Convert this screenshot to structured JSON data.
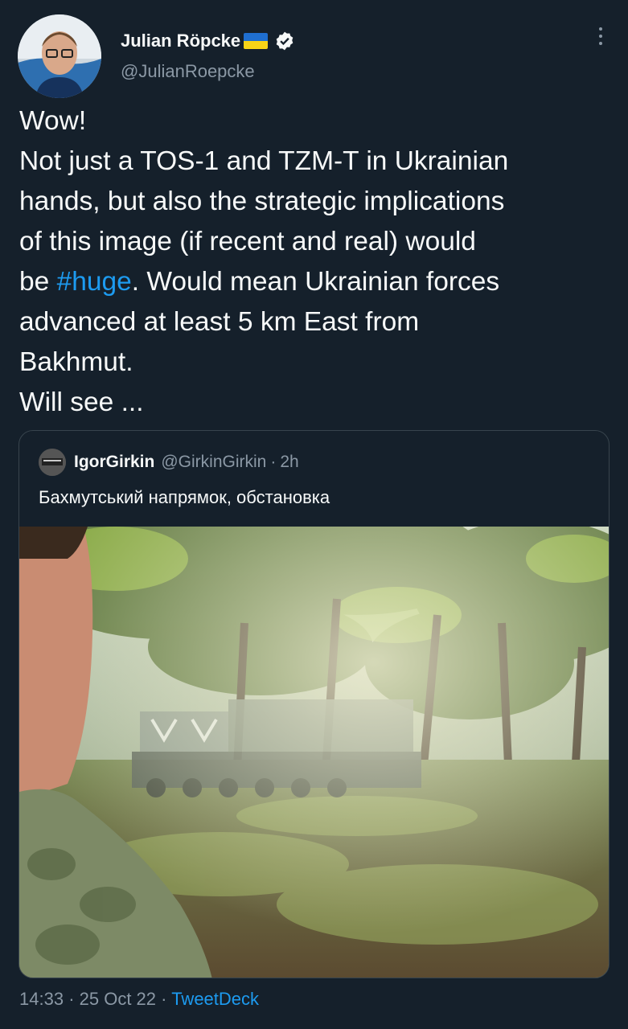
{
  "author": {
    "display_name": "Julian Röpcke",
    "handle": "@JulianRoepcke",
    "verified_icon": "verified-badge-icon",
    "flag_icon": "ukraine-flag-icon",
    "flag_colors": [
      "#1f6fd1",
      "#f7d417"
    ]
  },
  "tweet": {
    "lines": [
      "Wow!",
      "Not just a TOS-1 and TZM-T in Ukrainian",
      "hands, but also the strategic implications",
      "of this image (if recent and real) would",
      "be ",
      "Will see ..."
    ],
    "line5_hashtag": "#huge",
    "line5_tail": ". Would mean Ukrainian forces",
    "line6": "advanced at least 5 km East from",
    "line7": "Bakhmut."
  },
  "quoted": {
    "name": "IgorGirkin",
    "handle": "@GirkinGirkin",
    "separator": "·",
    "time": "2h",
    "text": "Бахмутський напрямок, обстановка"
  },
  "footer": {
    "time": "14:33",
    "sep1": "·",
    "date": "25 Oct 22",
    "sep2": "·",
    "source": "TweetDeck"
  },
  "colors": {
    "background": "#15202b",
    "link": "#1d9bf0",
    "secondary_text": "#8b98a5"
  }
}
